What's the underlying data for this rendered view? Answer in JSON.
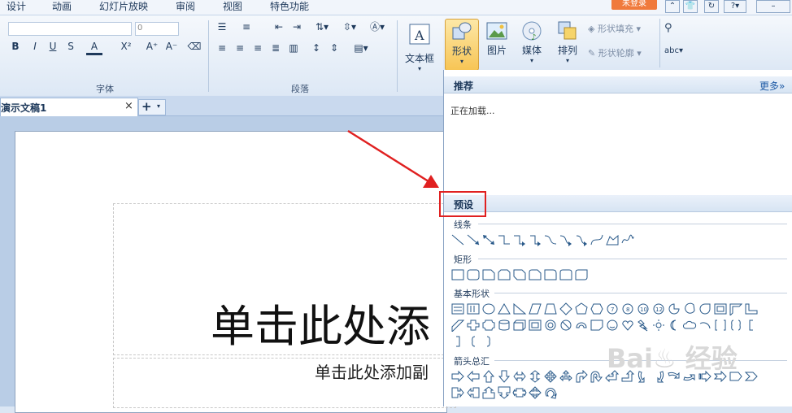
{
  "menu": {
    "items": [
      "设计",
      "动画",
      "幻灯片放映",
      "审阅",
      "视图",
      "特色功能"
    ],
    "login": "未登录"
  },
  "ribbon": {
    "font_name_value": "",
    "font_size_value": "0",
    "font_group_label": "字体",
    "paragraph_group_label": "段落",
    "font_buttons": [
      "B",
      "I",
      "U",
      "S",
      "A",
      "X²",
      "A⁺",
      "A⁻"
    ],
    "textbox_label": "文本框",
    "shape_label": "形状",
    "picture_label": "图片",
    "media_label": "媒体",
    "arrange_label": "排列",
    "shape_fill_label": "形状填充",
    "shape_outline_label": "形状轮廓"
  },
  "tabs": {
    "document_title": "演示文稿1",
    "close_glyph": "×",
    "new_tab_glyph": "+"
  },
  "slide": {
    "title_placeholder": "单击此处添",
    "subtitle_placeholder": "单击此处添加副"
  },
  "shapes_panel": {
    "recommend_label": "推荐",
    "more_label": "更多»",
    "loading_text": "正在加载...",
    "preset_label": "预设",
    "sections": [
      "线条",
      "矩形",
      "基本形状",
      "箭头总汇"
    ]
  },
  "colors": {
    "accent_red": "#e02020",
    "active_button": "#f7c555",
    "login_bg": "#f07a3c"
  }
}
